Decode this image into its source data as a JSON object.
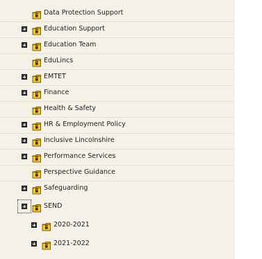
{
  "tree": {
    "items": [
      {
        "label": "Data Protection Support",
        "level": 1,
        "expander": false,
        "focused": false
      },
      {
        "label": "Education Support",
        "level": 1,
        "expander": true,
        "focused": false
      },
      {
        "label": "Education Team",
        "level": 1,
        "expander": true,
        "focused": false
      },
      {
        "label": "EduLincs",
        "level": 1,
        "expander": false,
        "focused": false
      },
      {
        "label": "EMTET",
        "level": 1,
        "expander": true,
        "focused": false
      },
      {
        "label": "Finance",
        "level": 1,
        "expander": true,
        "focused": false
      },
      {
        "label": "Health & Safety",
        "level": 1,
        "expander": false,
        "focused": false
      },
      {
        "label": "HR & Employment Policy",
        "level": 1,
        "expander": true,
        "focused": false
      },
      {
        "label": "Inclusive Lincolnshire",
        "level": 1,
        "expander": true,
        "focused": false
      },
      {
        "label": "Performance Services",
        "level": 1,
        "expander": true,
        "focused": false
      },
      {
        "label": "Perspective Guidance",
        "level": 1,
        "expander": false,
        "focused": false
      },
      {
        "label": "Safeguarding",
        "level": 1,
        "expander": true,
        "focused": false
      },
      {
        "label": "SEND",
        "level": 1,
        "expander": true,
        "focused": true
      },
      {
        "label": "2020-2021",
        "level": 2,
        "expander": true,
        "focused": false
      },
      {
        "label": "2021-2022",
        "level": 2,
        "expander": true,
        "focused": false
      }
    ]
  },
  "icons": {
    "expander": "plus-box-icon",
    "folder": "folder-lock-icon"
  },
  "colors": {
    "panel_bg": "#f5f1e6",
    "folder_fill": "#e8b820",
    "folder_outline": "#7a5a00",
    "text": "#1e1e1e"
  }
}
